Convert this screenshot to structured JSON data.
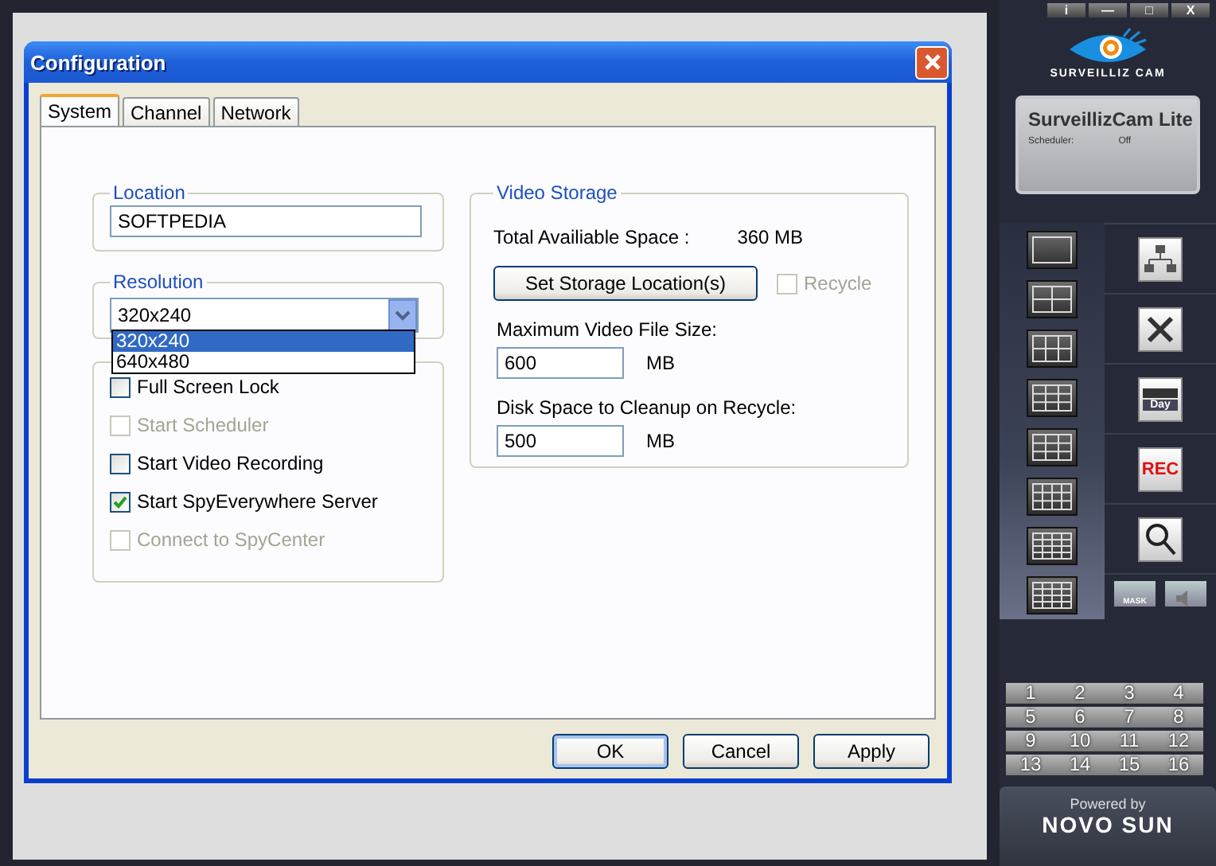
{
  "window": {
    "title": "Configuration"
  },
  "tabs": [
    {
      "label": "System",
      "selected": true
    },
    {
      "label": "Channel",
      "selected": false
    },
    {
      "label": "Network",
      "selected": false
    }
  ],
  "location": {
    "label": "Location",
    "value": "SOFTPEDIA"
  },
  "resolution": {
    "label": "Resolution",
    "value": "320x240",
    "expanded": true,
    "options": [
      {
        "label": "320x240",
        "selected": true
      },
      {
        "label": "640x480",
        "selected": false
      }
    ]
  },
  "options": [
    {
      "label": "Full Screen Lock",
      "checked": false,
      "disabled": false
    },
    {
      "label": "Start Scheduler",
      "checked": false,
      "disabled": true
    },
    {
      "label": "Start Video Recording",
      "checked": false,
      "disabled": false
    },
    {
      "label": "Start SpyEverywhere Server",
      "checked": true,
      "disabled": false
    },
    {
      "label": "Connect to SpyCenter",
      "checked": false,
      "disabled": true
    }
  ],
  "video_storage": {
    "label": "Video Storage",
    "total_space_label": "Total Availiable Space :",
    "total_space_value": "360 MB",
    "set_location_button": "Set Storage Location(s)",
    "recycle": {
      "label": "Recycle",
      "checked": false,
      "disabled": true
    },
    "fields": [
      {
        "label": "Maximum Video File Size:",
        "value": "600",
        "unit": "MB"
      },
      {
        "label": "Disk Space to Cleanup on Recycle:",
        "value": "500",
        "unit": "MB"
      }
    ]
  },
  "buttons": [
    {
      "label": "OK",
      "default": true
    },
    {
      "label": "Cancel",
      "default": false
    },
    {
      "label": "Apply",
      "default": false
    }
  ],
  "side_panel": {
    "window_buttons": [
      "i",
      "—",
      "□",
      "X"
    ],
    "logo": "SURVEILLIZ CAM",
    "product": "SurveillizCam Lite",
    "status_label": "Scheduler:",
    "status_value": "Off",
    "rec_label": "REC",
    "calendar_label": "Day",
    "mask_label": "MASK",
    "channels": [
      "1",
      "2",
      "3",
      "4",
      "5",
      "6",
      "7",
      "8",
      "9",
      "10",
      "11",
      "12",
      "13",
      "14",
      "15",
      "16"
    ],
    "powered_by": "Powered by",
    "brand": "NOVO SUN"
  }
}
